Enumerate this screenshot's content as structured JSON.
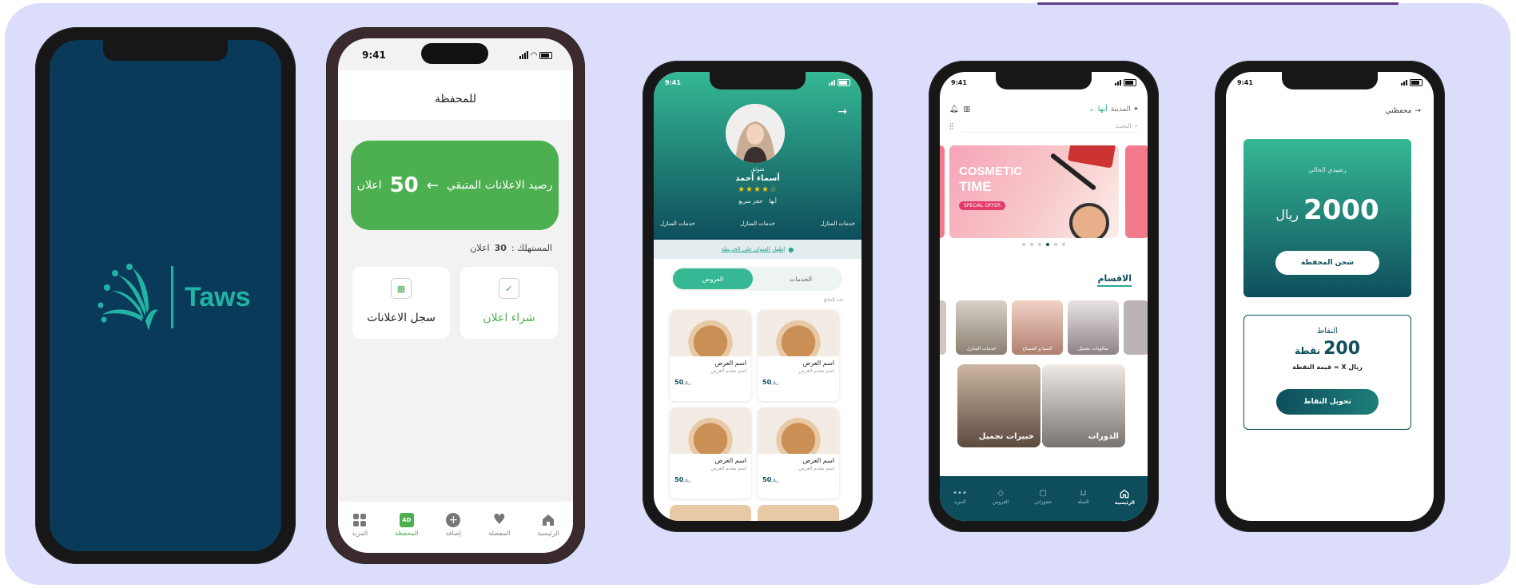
{
  "status": {
    "time": "9:41"
  },
  "splash": {
    "brand": "Taws"
  },
  "wallet_ads": {
    "title": "للمحفظة",
    "balance_label": "رصيد الاعلانات المتبقي",
    "arrow": "←",
    "balance_value": "50",
    "balance_unit": "اعلان",
    "consumed_label": "المستهلك :",
    "consumed_value": "30",
    "consumed_unit": "اعلان",
    "buy_ad": "شراء اعلان",
    "ads_log": "سجل الاعلانات",
    "nav": [
      {
        "label": "الرئيسية",
        "icon": "home-icon"
      },
      {
        "label": "المفضلة",
        "icon": "heart-icon"
      },
      {
        "label": "إضافة",
        "icon": "plus-circle-icon"
      },
      {
        "label": "المحفظة",
        "icon": "wallet-icon",
        "badge": "AD",
        "active": true
      },
      {
        "label": "المزيد",
        "icon": "grid-icon"
      }
    ],
    "accent": "#4caf50"
  },
  "profile": {
    "badge": "متوثق",
    "name": "أسماء أحمد",
    "city": "أبها",
    "quick_booking": "حجز سريع",
    "services": [
      "خدمات المنازل",
      "خدمات المنازل",
      "خدمات المنازل"
    ],
    "map_link": "إظهار العنوان على الخريطة",
    "tabs": {
      "services": "الخدمات",
      "offers": "العروض"
    },
    "sort_hint": "عدد النتائج",
    "cards": [
      {
        "title": "اسم العرض",
        "provider": "اسم مقدم العرض",
        "price": "50",
        "currency": "ريال"
      },
      {
        "title": "اسم العرض",
        "provider": "اسم مقدم العرض",
        "price": "50",
        "currency": "ريال"
      },
      {
        "title": "اسم العرض",
        "provider": "اسم مقدم العرض",
        "price": "50",
        "currency": "ريال"
      },
      {
        "title": "اسم العرض",
        "provider": "اسم مقدم العرض",
        "price": "50",
        "currency": "ريال"
      }
    ]
  },
  "home": {
    "city_label": "المدينة",
    "city_value": "أبها",
    "search_placeholder": "البحث",
    "banner_line1": "COSMETIC",
    "banner_line2": "TIME",
    "banner_tag": "SPECIAL OFFER",
    "sections_title": "الاقسام",
    "categories": [
      "صالونات تجميل",
      "السبا و المساج",
      "خدمات المنازل"
    ],
    "big_categories": [
      "الدورات",
      "خبيرات تجميل"
    ],
    "nav": [
      {
        "label": "الرئيسية",
        "icon": "home-icon",
        "active": true
      },
      {
        "label": "السلة",
        "icon": "cart-icon"
      },
      {
        "label": "حجوزاتي",
        "icon": "bag-icon"
      },
      {
        "label": "العروض",
        "icon": "tag-icon"
      },
      {
        "label": "المزيد",
        "icon": "more-icon"
      }
    ]
  },
  "wallet": {
    "back_label": "محفظتي",
    "current_balance_label": "رصيدي الحالي",
    "balance_value": "2000",
    "currency": "ريال",
    "topup": "شحن المحفظة",
    "points_title": "النقاط",
    "points_value": "200",
    "points_unit": "نقطة",
    "point_value_text": "ريال X = قيمة النقطة",
    "convert": "تحويل النقاط"
  },
  "colors": {
    "teal": "#0e4e5c",
    "teal_light": "#2aa88e",
    "background": "#dcdcfb",
    "splash": "#093a59"
  }
}
